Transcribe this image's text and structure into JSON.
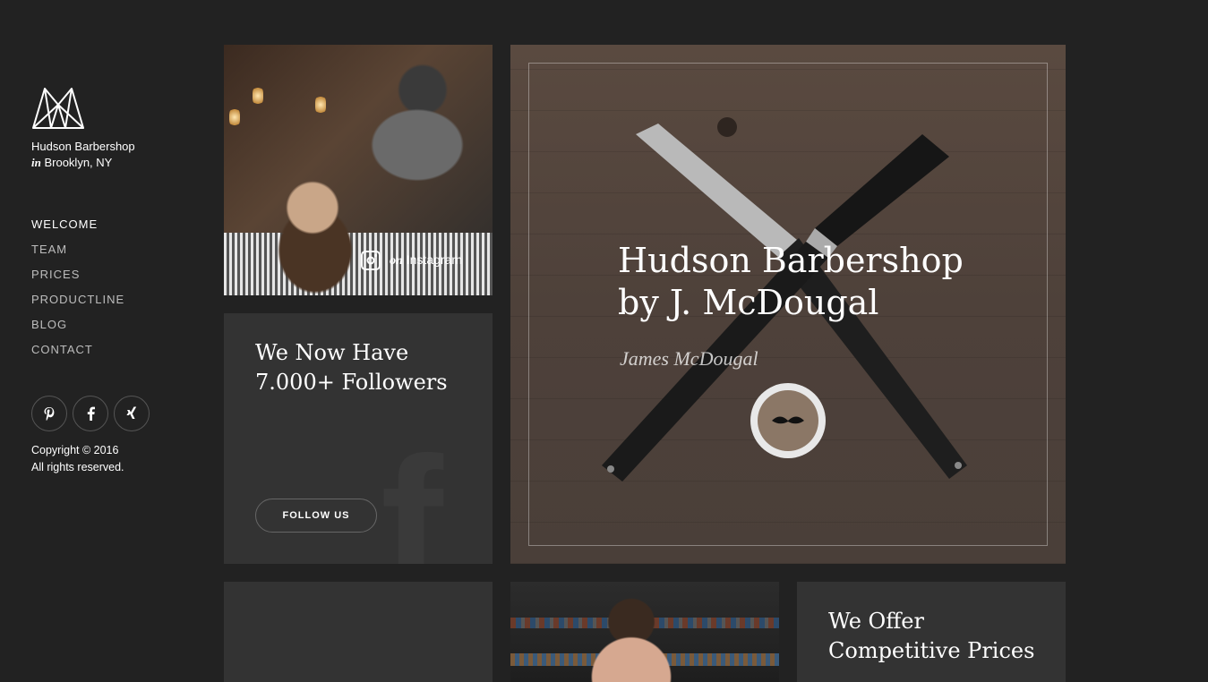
{
  "brand": {
    "logo_icon": "geometric-m-logo-icon",
    "name": "Hudson Barbershop",
    "location_prefix": "in",
    "location": "Brooklyn, NY"
  },
  "nav": {
    "items": [
      {
        "label": "WELCOME",
        "active": true
      },
      {
        "label": "TEAM",
        "active": false
      },
      {
        "label": "PRICES",
        "active": false
      },
      {
        "label": "PRODUCTLINE",
        "active": false
      },
      {
        "label": "BLOG",
        "active": false
      },
      {
        "label": "CONTACT",
        "active": false
      }
    ]
  },
  "social": {
    "icons": [
      "pinterest-icon",
      "facebook-icon",
      "xing-icon"
    ]
  },
  "copyright": {
    "line1": "Copyright © 2016",
    "line2": "All rights reserved."
  },
  "instagram_tile": {
    "prefix": "on",
    "label": "Instagram",
    "icon": "instagram-icon"
  },
  "followers_tile": {
    "title": "We Now Have 7.000+ Followers",
    "button_label": "FOLLOW US",
    "watermark_icon": "facebook-icon"
  },
  "hero": {
    "line1": "Hudson Barbershop",
    "line2": "by J. McDougal",
    "signature": "James McDougal"
  },
  "prices_tile": {
    "title": "We Offer Competitive Prices"
  },
  "colors": {
    "background": "#222222",
    "tile": "#333333",
    "text": "#ffffff",
    "muted": "#bdbdbd"
  }
}
